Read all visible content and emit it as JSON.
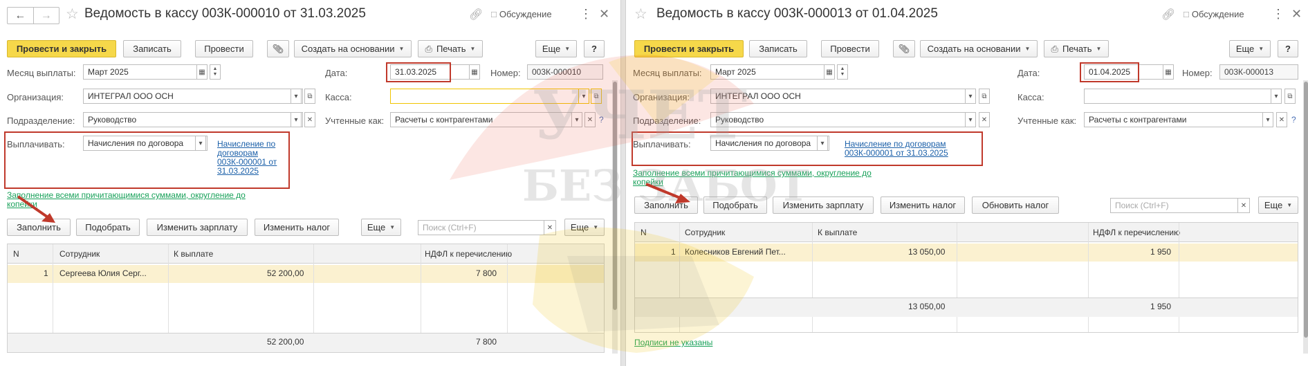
{
  "left": {
    "title": "Ведомость в кассу 003К-000010 от 31.03.2025",
    "discussion_label": "Обсуждение",
    "toolbar": {
      "post_close": "Провести и закрыть",
      "save": "Записать",
      "post": "Провести",
      "create_based": "Создать на основании",
      "print": "Печать",
      "more": "Еще",
      "help": "?"
    },
    "form": {
      "month_label": "Месяц выплаты:",
      "month_value": "Март 2025",
      "date_label": "Дата:",
      "date_value": "31.03.2025",
      "number_label": "Номер:",
      "number_value": "003К-000010",
      "org_label": "Организация:",
      "org_value": "ИНТЕГРАЛ ООО ОСН",
      "cash_label": "Касса:",
      "cash_value": "",
      "dept_label": "Подразделение:",
      "dept_value": "Руководство",
      "accounted_label": "Учтенные как:",
      "accounted_value": "Расчеты с контрагентами",
      "pay_label": "Выплачивать:",
      "pay_value": "Начисления по договора",
      "pay_link_lines": [
        "Начисление по",
        "договорам",
        "003К-000001 от",
        "31.03.2025"
      ],
      "fill_all_link_lines": [
        "Заполнение всеми причитающимися суммами, округление до",
        "копейки"
      ]
    },
    "table_toolbar": {
      "fill": "Заполнить",
      "pick": "Подобрать",
      "change_salary": "Изменить зарплату",
      "change_tax": "Изменить налог",
      "more": "Еще",
      "search_placeholder": "Поиск (Ctrl+F)",
      "more2": "Еще"
    },
    "table": {
      "headers": [
        "N",
        "Сотрудник",
        "К выплате",
        "НДФЛ к перечислению"
      ],
      "rows": [
        {
          "n": "1",
          "employee": "Сергеева Юлия Серг...",
          "amount": "52 200,00",
          "tax": "7 800"
        }
      ],
      "total_amount": "52 200,00",
      "total_tax": "7 800"
    }
  },
  "right": {
    "title": "Ведомость в кассу 003К-000013 от 01.04.2025",
    "discussion_label": "Обсуждение",
    "toolbar": {
      "post_close": "Провести и закрыть",
      "save": "Записать",
      "post": "Провести",
      "create_based": "Создать на основании",
      "print": "Печать",
      "more": "Еще",
      "help": "?"
    },
    "form": {
      "month_label": "Месяц выплаты:",
      "month_value": "Март 2025",
      "date_label": "Дата:",
      "date_value": "01.04.2025",
      "number_label": "Номер:",
      "number_value": "003К-000013",
      "org_label": "Организация:",
      "org_value": "ИНТЕГРАЛ ООО ОСН",
      "cash_label": "Касса:",
      "cash_value": "",
      "dept_label": "Подразделение:",
      "dept_value": "Руководство",
      "accounted_label": "Учтенные как:",
      "accounted_value": "Расчеты с контрагентами",
      "pay_label": "Выплачивать:",
      "pay_value": "Начисления по договора",
      "pay_link_lines": [
        "Начисление по договорам",
        "003К-000001 от 31.03.2025"
      ],
      "fill_all_link_lines": [
        "Заполнение всеми причитающимися суммами, округление до",
        "копейки"
      ]
    },
    "table_toolbar": {
      "fill": "Заполнить",
      "pick": "Подобрать",
      "change_salary": "Изменить зарплату",
      "change_tax": "Изменить налог",
      "update_tax": "Обновить налог",
      "search_placeholder": "Поиск (Ctrl+F)",
      "more": "Еще"
    },
    "table": {
      "headers": [
        "N",
        "Сотрудник",
        "К выплате",
        "НДФЛ к перечислению"
      ],
      "rows": [
        {
          "n": "1",
          "employee": "Колесников Евгений Пет...",
          "amount": "13 050,00",
          "tax": "1 950"
        }
      ],
      "total_amount": "13 050,00",
      "total_tax": "1 950"
    },
    "signatures_link": "Подписи не указаны"
  },
  "watermark": {
    "line1": "УЧЕТ",
    "line2": "БЕЗ ЗАБОТ"
  },
  "colors": {
    "primary_button": "#f6d84a",
    "highlight_box": "#c0392b",
    "selected_row": "#fbf1d0",
    "link_blue": "#1a5fa8",
    "link_green": "#19a15a"
  }
}
